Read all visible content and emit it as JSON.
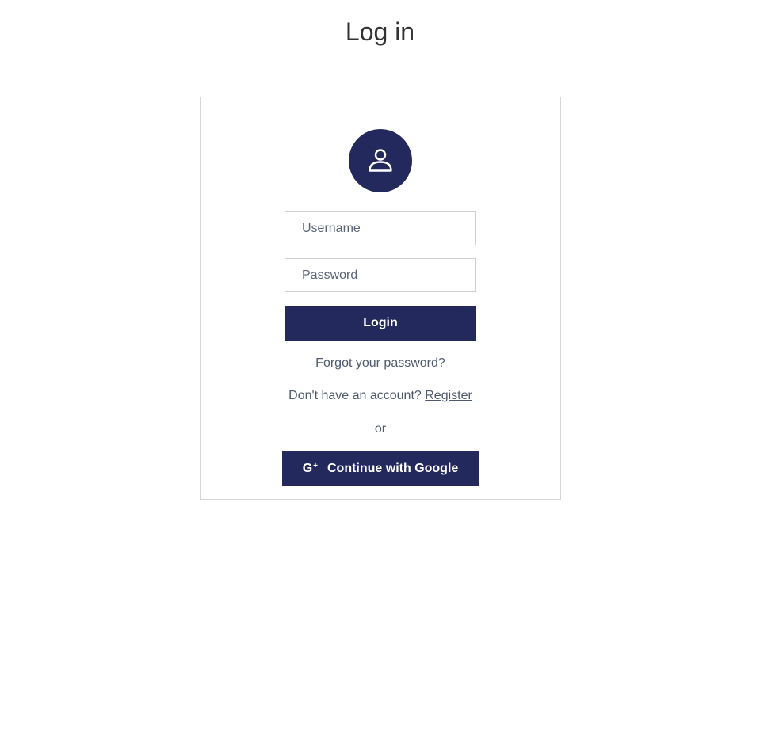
{
  "page": {
    "title": "Log in"
  },
  "form": {
    "username_placeholder": "Username",
    "password_placeholder": "Password",
    "login_label": "Login",
    "forgot_label": "Forgot your password?",
    "register_prompt": "Don't have an account?",
    "register_label": "Register",
    "or_label": "or",
    "google_label": "Continue with Google"
  },
  "icons": {
    "avatar": "user-icon",
    "google": "google-plus-icon"
  },
  "colors": {
    "primary": "#24295d",
    "text": "#4f5a6c",
    "border": "#d6d6d6"
  }
}
